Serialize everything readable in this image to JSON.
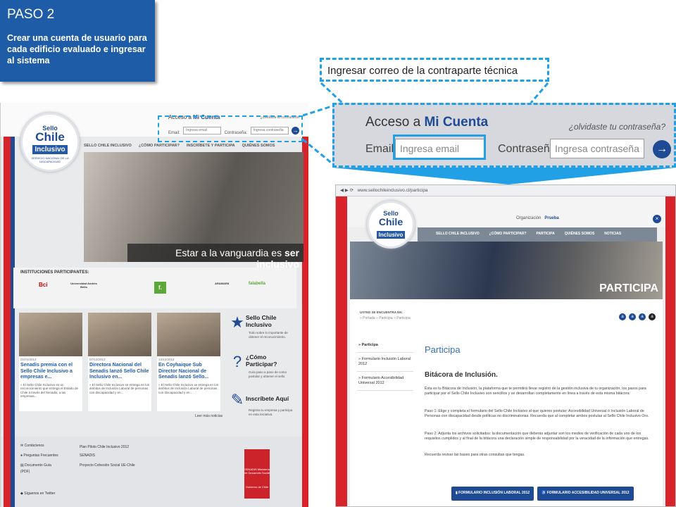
{
  "step": {
    "title": "PASO 2",
    "desc": "Crear una cuenta de usuario para cada edificio evaluado e ingresar al sistema"
  },
  "callout": "Ingresar correo de la contraparte técnica",
  "logo": {
    "l1": "Sello",
    "l2": "Chile",
    "l3": "Inclusivo",
    "l4": "SERVICIO NACIONAL DE LA DISCAPACIDAD"
  },
  "left": {
    "account": {
      "title_a": "Acceso a",
      "title_b": "Mi Cuenta",
      "forgot": "¿olvidaste tu contraseña?",
      "email_label": "Email:",
      "email_ph": "Ingresa email",
      "pass_label": "Contraseña:",
      "pass_ph": "Ingresa contraseña"
    },
    "nav": [
      "SELLO CHILE INCLUSIVO",
      "¿CÓMO PARTICIPAR?",
      "INSCRÍBETE Y PARTICIPA",
      "QUIÉNES SOMOS"
    ],
    "hero_a": "Estar a la vanguardia es",
    "hero_b": "ser inclusivo",
    "inst_title": "INSTITUCIONES PARTICIPANTES:",
    "inst": [
      "Bci",
      "Universidad Andrés Bello",
      "",
      "f.",
      "",
      "ARAMARK",
      "falabella"
    ],
    "news": [
      {
        "date": "21/01/2013",
        "title": "Senadis premia con el Sello Chile Inclusivo a empresas e...",
        "text": "» El Sello Chile Inclusivo es un reconocimiento que entrega el Estado de Chile a través del Senadis, a las empresas..."
      },
      {
        "date": "07/12/2012",
        "title": "Directora Nacional del Senadis lanzó Sello Chile Inclusivo en...",
        "text": "» El Sello Chile Inclusivo se entrega en los ámbitos de Inclusión Laboral de personas con discapacidad y en..."
      },
      {
        "date": "14/12/2012",
        "title": "En Coyhaique Sub Director Nacional de Senadis lanzó Sello...",
        "text": "» El Sello Chile Inclusivo se entrega en los ámbitos de Inclusión Laboral de personas con discapacidad y en..."
      }
    ],
    "more_news": "Leer más noticias",
    "side": [
      {
        "title": "Sello Chile Inclusivo",
        "text": "Todo sobre lo importante de obtener el reconocimiento."
      },
      {
        "title": "¿Cómo Participar?",
        "text": "Guía paso a paso de como postular y obtener el sello."
      },
      {
        "title": "Inscríbete Aquí",
        "text": "Registra tu empresa y participa en esta iniciativa."
      }
    ],
    "footer": {
      "contact": "Contáctenos",
      "faq": "Preguntas Frecuentes",
      "doc": "Documento Guía",
      "doc_sub": "(PDF)",
      "twitter": "Síguenos en Twitter",
      "plan": "Plan Piloto Chile Inclusivo 2012",
      "senadis": "SENADIS",
      "project": "Proyecto Cohesión Social UE-Chile",
      "badge": "SENADIS Ministerio de Desarrollo Social",
      "gov": "Gobierno de Chile"
    }
  },
  "zoom": {
    "title_a": "Acceso a",
    "title_b": "Mi Cuenta",
    "forgot": "¿olvidaste tu contraseña?",
    "email_label": "Email:",
    "email_ph": "Ingresa email",
    "pass_label": "Contraseña:",
    "pass_ph": "Ingresa contraseña"
  },
  "right": {
    "url": "www.sellochileinclusivo.cl/participa",
    "org_label": "Organización",
    "org_value": "Prueba",
    "nav": [
      "SELLO CHILE INCLUSIVO",
      "¿CÓMO PARTICIPAR?",
      "PARTICIPA",
      "QUIÉNES SOMOS",
      "NOTICIAS"
    ],
    "hero": "PARTICIPA",
    "crumb_title": "USTED SE ENCUENTRA EN:",
    "crumb": "» Portada   » Participa   » Participa",
    "menu": [
      "» Participa",
      "» Formulario Inclusión Laboral 2012",
      "» Formulario Accesibilidad Universal 2012"
    ],
    "h1": "Participa",
    "h2": "Bitácora de Inclusión.",
    "p1": "Ésta es tu Bitácora de Inclusión, la plataforma que te permitirá llevar registro de la gestión inclusiva de tu organización, los pasos para participar por el Sello Chile Inclusivo son sencillos y se desarrollan completamente en línea a través de esta misma bitácora:",
    "p2": "Paso 1: Elige y completa el formulario del Sello Chile Inclusivo al que quieres postular: Accesibilidad Universal ó Inclusión Laboral de Personas con discapacidad desde políticas no discriminatorias. Recuerda que al completar ambos postulas al Sello Chile Inclusivo Oro.",
    "p3": "Paso 2: Adjunta los archivos solicitados: la documentación que deberás adjuntar son los medios de verificación de cada uno de los requisitos cumplidos y al final de la bitácora una declaración simple de responsabilidad por la veracidad de la información que entregas.",
    "p4": "Recuerda revisar las bases para otras consultas que tengas.",
    "btn1": "FORMULARIO INCLUSIÓN LABORAL 2012",
    "btn2": "FORMULARIO ACCESIBILIDAD UNIVERSAL 2012"
  }
}
